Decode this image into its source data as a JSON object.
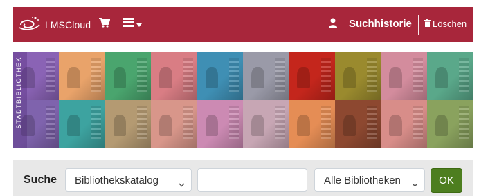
{
  "navbar": {
    "brand": "LMSCloud",
    "history_label": "Suchhistorie",
    "clear_label": "Löschen",
    "colors": {
      "bg": "#a8263b",
      "text": "#ffffff"
    },
    "icons": [
      "logo-swirl-icon",
      "cart-icon",
      "list-icon",
      "caret-down-icon",
      "user-icon",
      "trash-icon"
    ]
  },
  "banner": {
    "vertical_text": "STADTBIBLIOTHEK",
    "tile_colors": [
      "#8a63b5",
      "#e9a36a",
      "#4aa56e",
      "#d97d84",
      "#3f8fb4",
      "#9a9aa8",
      "#c4261c",
      "#9a8a2e",
      "#d38c9d",
      "#5aa88a",
      "#7f63ad",
      "#3da3a0",
      "#b49a72",
      "#d8968a",
      "#cc8ab3",
      "#c7a6b4",
      "#e58d55",
      "#8d4830",
      "#d88d89",
      "#8aa25e"
    ]
  },
  "search": {
    "label": "Suche",
    "catalog_value": "Bibliothekskatalog",
    "query_value": "",
    "libraries_value": "Alle Bibliotheken",
    "submit_label": "OK"
  }
}
